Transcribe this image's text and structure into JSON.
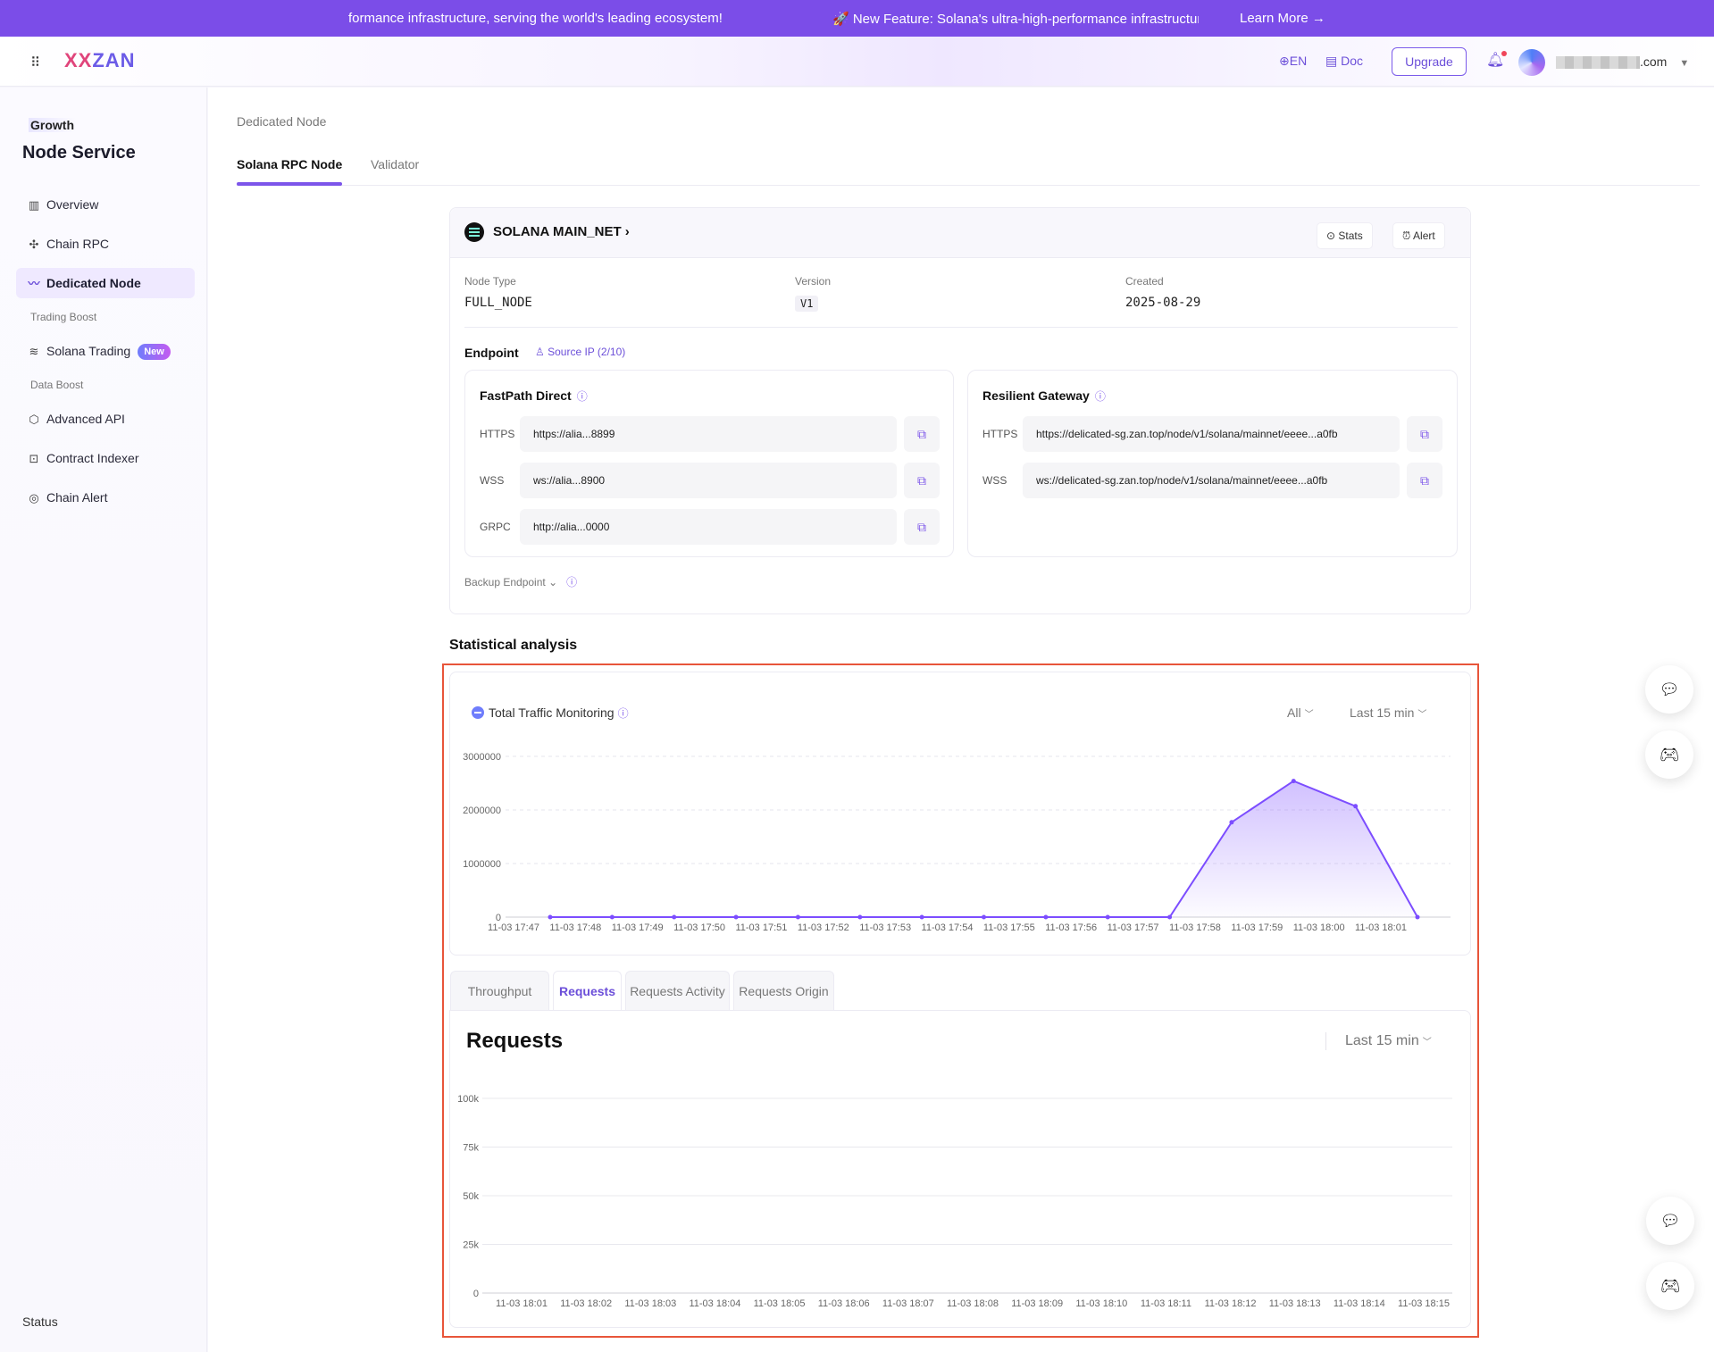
{
  "banner": {
    "text_left": "formance infrastructure, serving the world's leading ecosystem!",
    "text_right": "🚀 New Feature: Solana's ultra-high-performance infrastructure",
    "learn_more": "Learn More →"
  },
  "topbar": {
    "logo_part1": "XX",
    "logo_part2": "ZAN",
    "lang": "⊕EN",
    "doc": "▤ Doc",
    "upgrade": "Upgrade",
    "account_suffix": ".com"
  },
  "sidebar": {
    "plan": "Growth",
    "title": "Node Service",
    "items": [
      {
        "label": "Overview",
        "icon": "chart-box-icon"
      },
      {
        "label": "Chain RPC",
        "icon": "network-icon"
      },
      {
        "label": "Dedicated Node",
        "icon": "activity-icon"
      },
      {
        "label": "Solana Trading",
        "icon": "solana-icon",
        "badge": "New"
      },
      {
        "label": "Advanced API",
        "icon": "cube-icon"
      },
      {
        "label": "Contract Indexer",
        "icon": "code-box-icon"
      },
      {
        "label": "Chain Alert",
        "icon": "radar-icon"
      }
    ],
    "groups": [
      "Trading Boost",
      "Data Boost"
    ],
    "status": "Status"
  },
  "page": {
    "breadcrumb": "Dedicated Node",
    "tabs": [
      "Solana RPC Node",
      "Validator"
    ]
  },
  "node": {
    "name": "SOLANA MAIN_NET",
    "stats_btn": "Stats",
    "alert_btn": "Alert",
    "node_type_label": "Node Type",
    "node_type": "FULL_NODE",
    "version_label": "Version",
    "version": "V1",
    "created_label": "Created",
    "created": "2025-08-29",
    "endpoint_label": "Endpoint",
    "source_ip": "Source IP (2/10)",
    "fastpath": {
      "title": "FastPath Direct",
      "rows": [
        {
          "proto": "HTTPS",
          "value": "https://alia...8899"
        },
        {
          "proto": "WSS",
          "value": "ws://alia...8900"
        },
        {
          "proto": "GRPC",
          "value": "http://alia...0000"
        }
      ]
    },
    "gateway": {
      "title": "Resilient Gateway",
      "rows": [
        {
          "proto": "HTTPS",
          "value": "https://delicated-sg.zan.top/node/v1/solana/mainnet/eeee...a0fb"
        },
        {
          "proto": "WSS",
          "value": "ws://delicated-sg.zan.top/node/v1/solana/mainnet/eeee...a0fb"
        }
      ]
    },
    "backup": "Backup Endpoint ⌄"
  },
  "stats": {
    "title": "Statistical analysis",
    "traffic_title": "Total Traffic Monitoring",
    "filter_all": "All",
    "range": "Last 15 min",
    "tabs": [
      "Throughput",
      "Requests",
      "Requests Activity",
      "Requests Origin"
    ],
    "requests_title": "Requests",
    "requests_range": "Last 15 min"
  },
  "chart_data": [
    {
      "type": "area",
      "title": "Total Traffic Monitoring",
      "x": [
        "11-03 17:47",
        "11-03 17:48",
        "11-03 17:49",
        "11-03 17:50",
        "11-03 17:51",
        "11-03 17:52",
        "11-03 17:53",
        "11-03 17:54",
        "11-03 17:55",
        "11-03 17:56",
        "11-03 17:57",
        "11-03 17:58",
        "11-03 17:59",
        "11-03 18:00",
        "11-03 18:01"
      ],
      "values": [
        0,
        0,
        0,
        0,
        0,
        0,
        0,
        0,
        0,
        0,
        0,
        1770000,
        2540000,
        2070000,
        0
      ],
      "yticks": [
        "0",
        "1000000",
        "2000000",
        "3000000"
      ],
      "ylim": [
        0,
        3000000
      ],
      "color": "#7c4dff"
    },
    {
      "type": "line",
      "title": "Requests",
      "x": [
        "11-03 18:01",
        "11-03 18:02",
        "11-03 18:03",
        "11-03 18:04",
        "11-03 18:05",
        "11-03 18:06",
        "11-03 18:07",
        "11-03 18:08",
        "11-03 18:09",
        "11-03 18:10",
        "11-03 18:11",
        "11-03 18:12",
        "11-03 18:13",
        "11-03 18:14",
        "11-03 18:15"
      ],
      "values": [],
      "yticks": [
        "0",
        "25k",
        "50k",
        "75k",
        "100k"
      ],
      "ylim": [
        0,
        100000
      ]
    }
  ]
}
